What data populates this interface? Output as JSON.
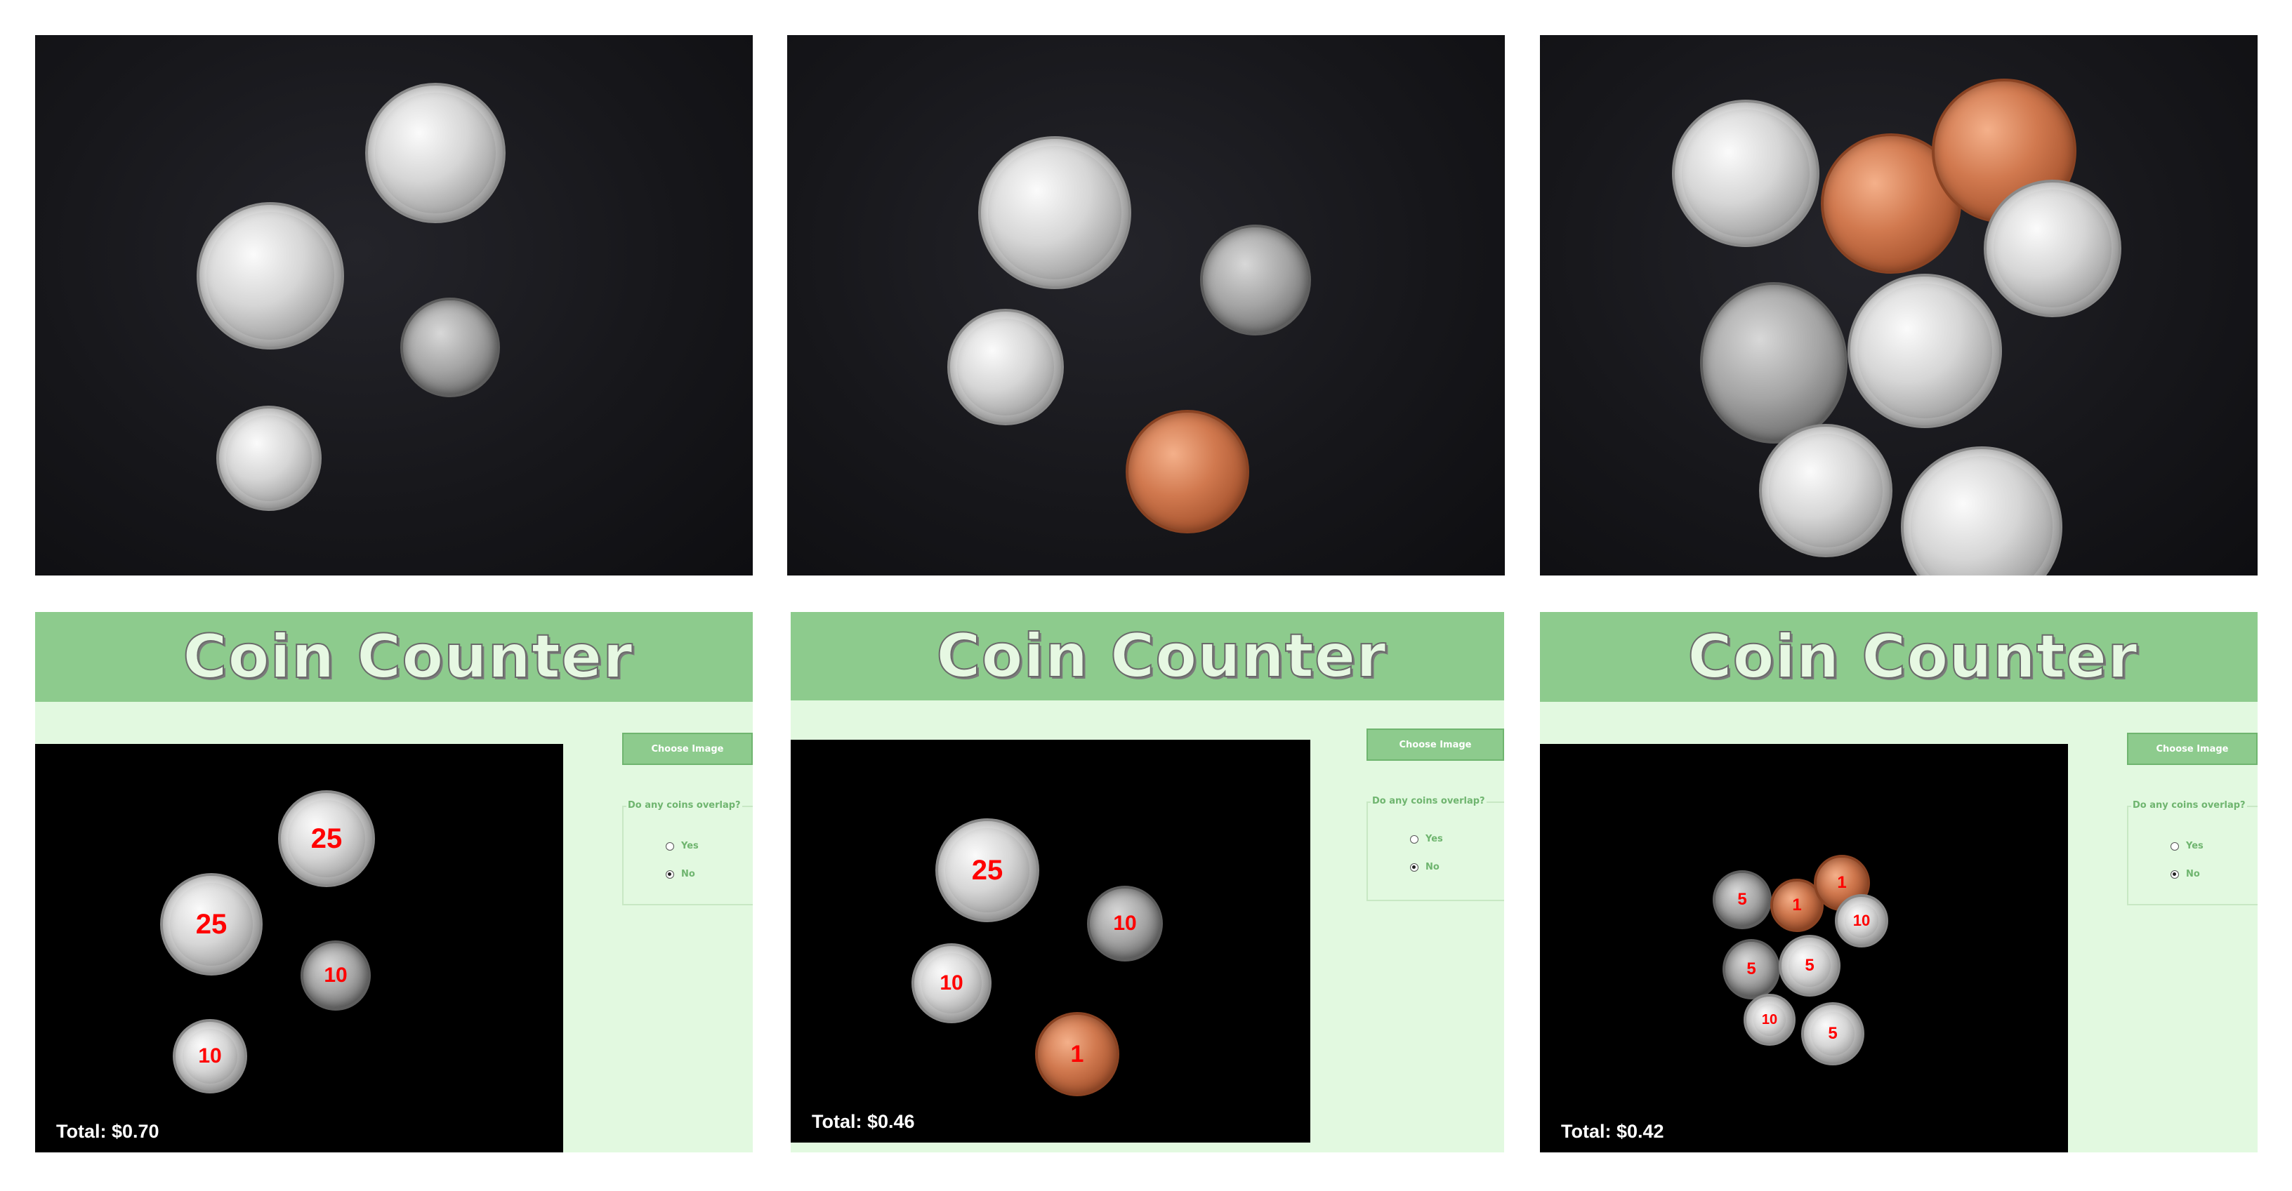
{
  "apps": [
    {
      "title": "Coin Counter",
      "choose_image_label": "Choose Image",
      "overlap_question": "Do any coins overlap?",
      "options": [
        {
          "label": "Yes",
          "checked": false
        },
        {
          "label": "No",
          "checked": true
        }
      ],
      "total_text": "Total: $0.70",
      "coin_labels": [
        "25",
        "25",
        "10",
        "10"
      ]
    },
    {
      "title": "Coin Counter",
      "choose_image_label": "Choose Image",
      "overlap_question": "Do any coins overlap?",
      "options": [
        {
          "label": "Yes",
          "checked": false
        },
        {
          "label": "No",
          "checked": true
        }
      ],
      "total_text": "Total: $0.46",
      "coin_labels": [
        "25",
        "10",
        "10",
        "1"
      ]
    },
    {
      "title": "Coin Counter",
      "choose_image_label": "Choose Image",
      "overlap_question": "Do any coins overlap?",
      "options": [
        {
          "label": "Yes",
          "checked": false
        },
        {
          "label": "No",
          "checked": true
        }
      ],
      "total_text": "Total: $0.42",
      "coin_labels": [
        "5",
        "1",
        "1",
        "10",
        "5",
        "5",
        "10",
        "5"
      ]
    }
  ]
}
